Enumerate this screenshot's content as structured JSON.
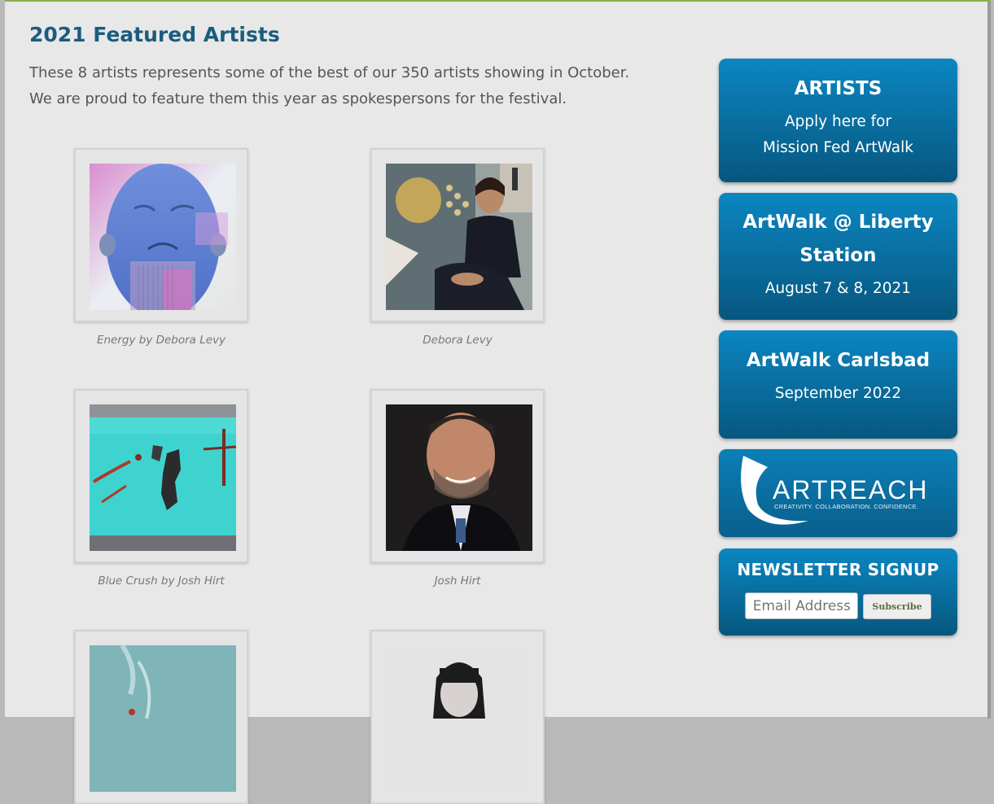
{
  "page": {
    "title": "2021 Featured Artists",
    "intro_line1": "These 8 artists represents some of the best of our 350 artists showing in October.",
    "intro_line2": "We are proud to feature them this year as spokespersons for the festival."
  },
  "gallery": [
    {
      "caption": "Energy by Debora Levy"
    },
    {
      "caption": "Debora Levy"
    },
    {
      "caption": "Blue Crush by Josh Hirt"
    },
    {
      "caption": "Josh Hirt"
    }
  ],
  "sidebar": {
    "artists": {
      "title": "ARTISTS",
      "line1": "Apply here for",
      "line2": "Mission Fed ArtWalk"
    },
    "liberty": {
      "title_line1": "ArtWalk @ Liberty",
      "title_line2": "Station",
      "date": "August 7 & 8, 2021"
    },
    "carlsbad": {
      "title": "ArtWalk Carlsbad",
      "date": "September 2022"
    },
    "artreach": {
      "logo_text": "ARTREACH",
      "tagline": "CREATIVITY. COLLABORATION. CONFIDENCE."
    },
    "newsletter": {
      "title": "NEWSLETTER SIGNUP",
      "email_placeholder": "Email Address",
      "subscribe_label": "Subscribe"
    }
  },
  "colors": {
    "heading": "#1b5c7e",
    "sidebar_blue_top": "#0b86c1",
    "sidebar_blue_bottom": "#07577f",
    "top_border": "#8bb04a"
  }
}
